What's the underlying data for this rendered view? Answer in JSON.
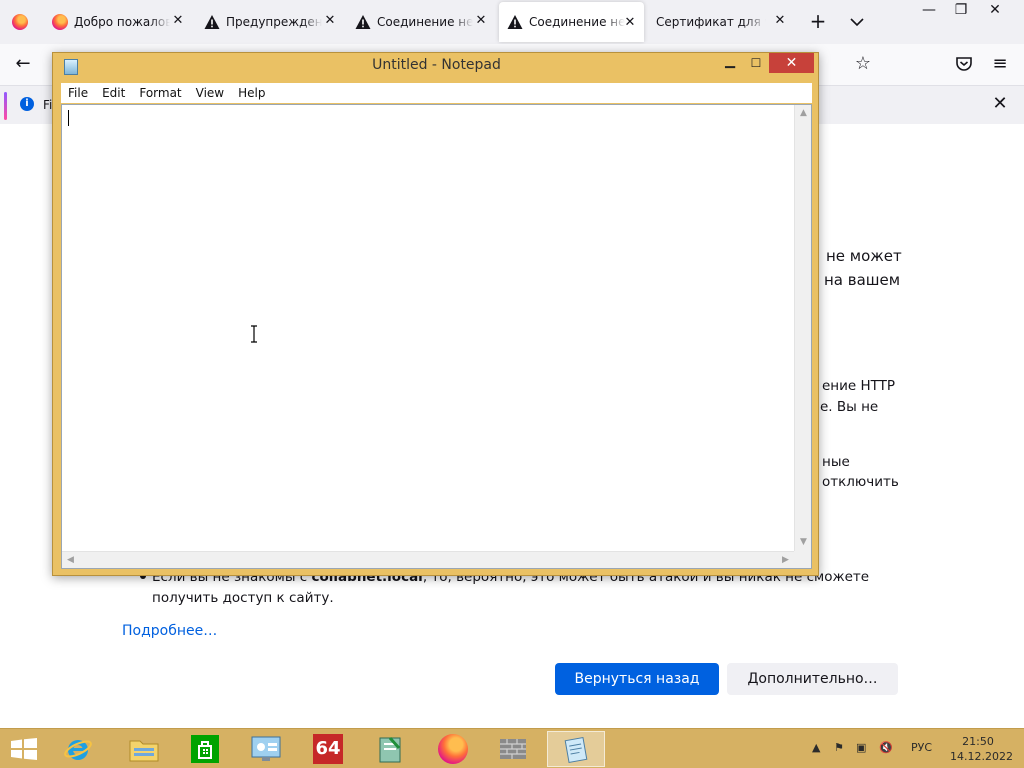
{
  "browser": {
    "tabs": [
      {
        "label": "Добро пожаловать",
        "icon": "firefox-icon",
        "active": false
      },
      {
        "label": "Предупреждение",
        "icon": "warning-icon",
        "active": false
      },
      {
        "label": "Соединение не уд",
        "icon": "warning-icon",
        "active": false
      },
      {
        "label": "Соединение не уд",
        "icon": "warning-icon",
        "active": true
      },
      {
        "label": "Сертификат для www",
        "icon": "none",
        "active": false
      }
    ],
    "tab_close_glyph": "✕",
    "new_tab_glyph": "+",
    "notification": {
      "text": "Fi",
      "close_glyph": "✕"
    }
  },
  "page": {
    "fragments": [
      {
        "text": "не может"
      },
      {
        "text": "на вашем"
      },
      {
        "text": "ение HTTP"
      },
      {
        "text": "е. Вы не"
      },
      {
        "text": "ные"
      },
      {
        "text": "отключить"
      }
    ],
    "bullet": {
      "line1_pre": "Если вы не знакомы с ",
      "line1_bold": "collabnet.local",
      "line1_post": ", то, вероятно, это может быть атакой и вы никак не сможете",
      "line2": "получить доступ к сайту."
    },
    "more_link": "Подробнее…",
    "go_back_button": "Вернуться назад",
    "advanced_button": "Дополнительно…"
  },
  "notepad": {
    "title": "Untitled - Notepad",
    "menu": [
      "File",
      "Edit",
      "Format",
      "View",
      "Help"
    ],
    "content": ""
  },
  "taskbar": {
    "apps": [
      "internet-explorer",
      "file-explorer",
      "store",
      "control-panel",
      "aida64",
      "clipboard-app",
      "firefox",
      "firewall-app",
      "notepad"
    ],
    "aida_label": "64",
    "language": "РУС",
    "time": "21:50",
    "date": "14.12.2022"
  },
  "colors": {
    "accent_blue": "#0061e0",
    "notepad_frame": "#eac164",
    "taskbar": "#d6b163",
    "close_red": "#c7413a"
  }
}
